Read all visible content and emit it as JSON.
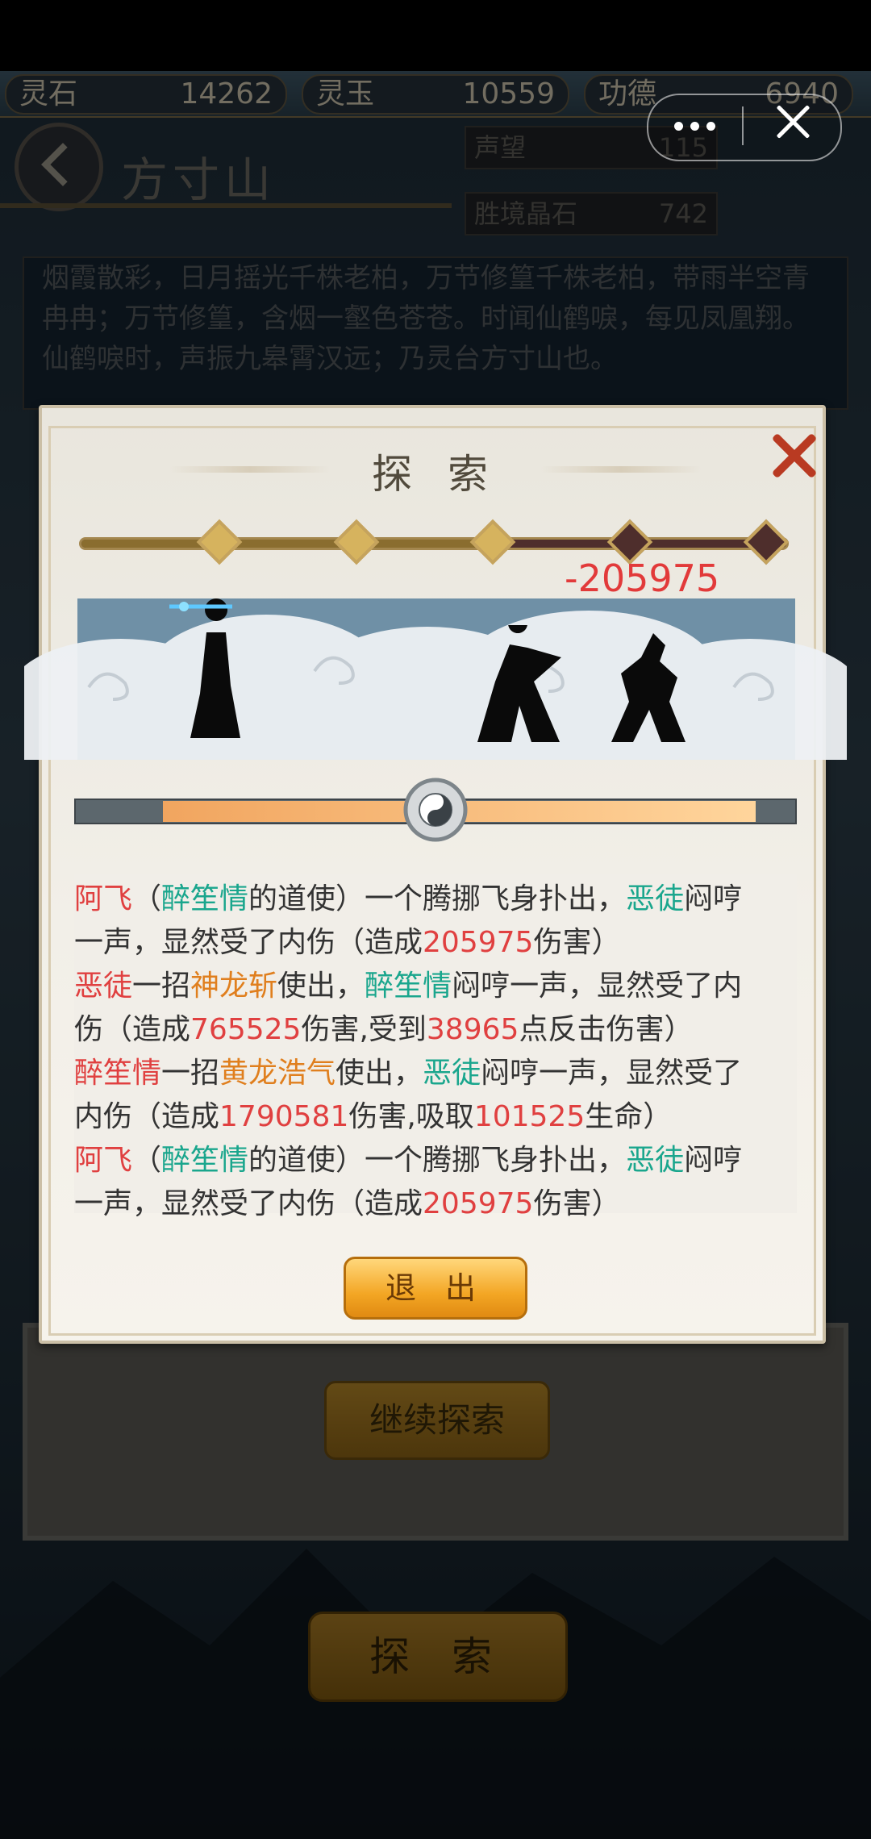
{
  "resources": [
    {
      "label": "灵石",
      "value": "14262"
    },
    {
      "label": "灵玉",
      "value": "10559"
    },
    {
      "label": "功德",
      "value": "6940"
    }
  ],
  "page": {
    "title": "方寸山",
    "stats": [
      {
        "label": "声望",
        "value": "115"
      },
      {
        "label": "胜境晶石",
        "value": "742"
      }
    ],
    "description": "烟霞散彩，日月摇光千株老柏，万节修篁千株老柏，带雨半空青冉冉；万节修篁，含烟一壑色苍苍。时闻仙鹤唳，每见凤凰翔。仙鹤唳时，声振九皋霄汉远；乃灵台方寸山也。",
    "continue_label": "继续探索",
    "explore_label": "探 索"
  },
  "modal": {
    "title": "探 索",
    "damage_popup": "-205975",
    "exit_label": "退 出",
    "progress": {
      "total_nodes": 5,
      "reached_nodes": 3
    },
    "hp_fraction": 0.82
  },
  "log": [
    [
      {
        "t": "阿飞",
        "c": "r"
      },
      {
        "t": "（"
      },
      {
        "t": "醉笙情",
        "c": "g"
      },
      {
        "t": "的道使）一个腾挪飞身扑出，"
      },
      {
        "t": "恶徒",
        "c": "g"
      },
      {
        "t": "闷哼"
      }
    ],
    [
      {
        "t": "一声，显然受了内伤（造成"
      },
      {
        "t": "205975",
        "c": "r"
      },
      {
        "t": "伤害）"
      }
    ],
    [
      {
        "t": "恶徒",
        "c": "r"
      },
      {
        "t": "一招"
      },
      {
        "t": "神龙斩",
        "c": "o"
      },
      {
        "t": "使出，"
      },
      {
        "t": "醉笙情",
        "c": "g"
      },
      {
        "t": "闷哼一声，显然受了内"
      }
    ],
    [
      {
        "t": "伤（造成"
      },
      {
        "t": "765525",
        "c": "r"
      },
      {
        "t": "伤害,受到"
      },
      {
        "t": "38965",
        "c": "r"
      },
      {
        "t": "点反击伤害）"
      }
    ],
    [
      {
        "t": "醉笙情",
        "c": "r"
      },
      {
        "t": "一招"
      },
      {
        "t": "黄龙浩气",
        "c": "o"
      },
      {
        "t": "使出，"
      },
      {
        "t": "恶徒",
        "c": "g"
      },
      {
        "t": "闷哼一声，显然受了"
      }
    ],
    [
      {
        "t": "内伤（造成"
      },
      {
        "t": "1790581",
        "c": "r"
      },
      {
        "t": "伤害,吸取"
      },
      {
        "t": "101525",
        "c": "r"
      },
      {
        "t": "生命）"
      }
    ],
    [
      {
        "t": "阿飞",
        "c": "r"
      },
      {
        "t": "（"
      },
      {
        "t": "醉笙情",
        "c": "g"
      },
      {
        "t": "的道使）一个腾挪飞身扑出，"
      },
      {
        "t": "恶徒",
        "c": "g"
      },
      {
        "t": "闷哼"
      }
    ],
    [
      {
        "t": "一声，显然受了内伤（造成"
      },
      {
        "t": "205975",
        "c": "r"
      },
      {
        "t": "伤害）"
      }
    ]
  ]
}
